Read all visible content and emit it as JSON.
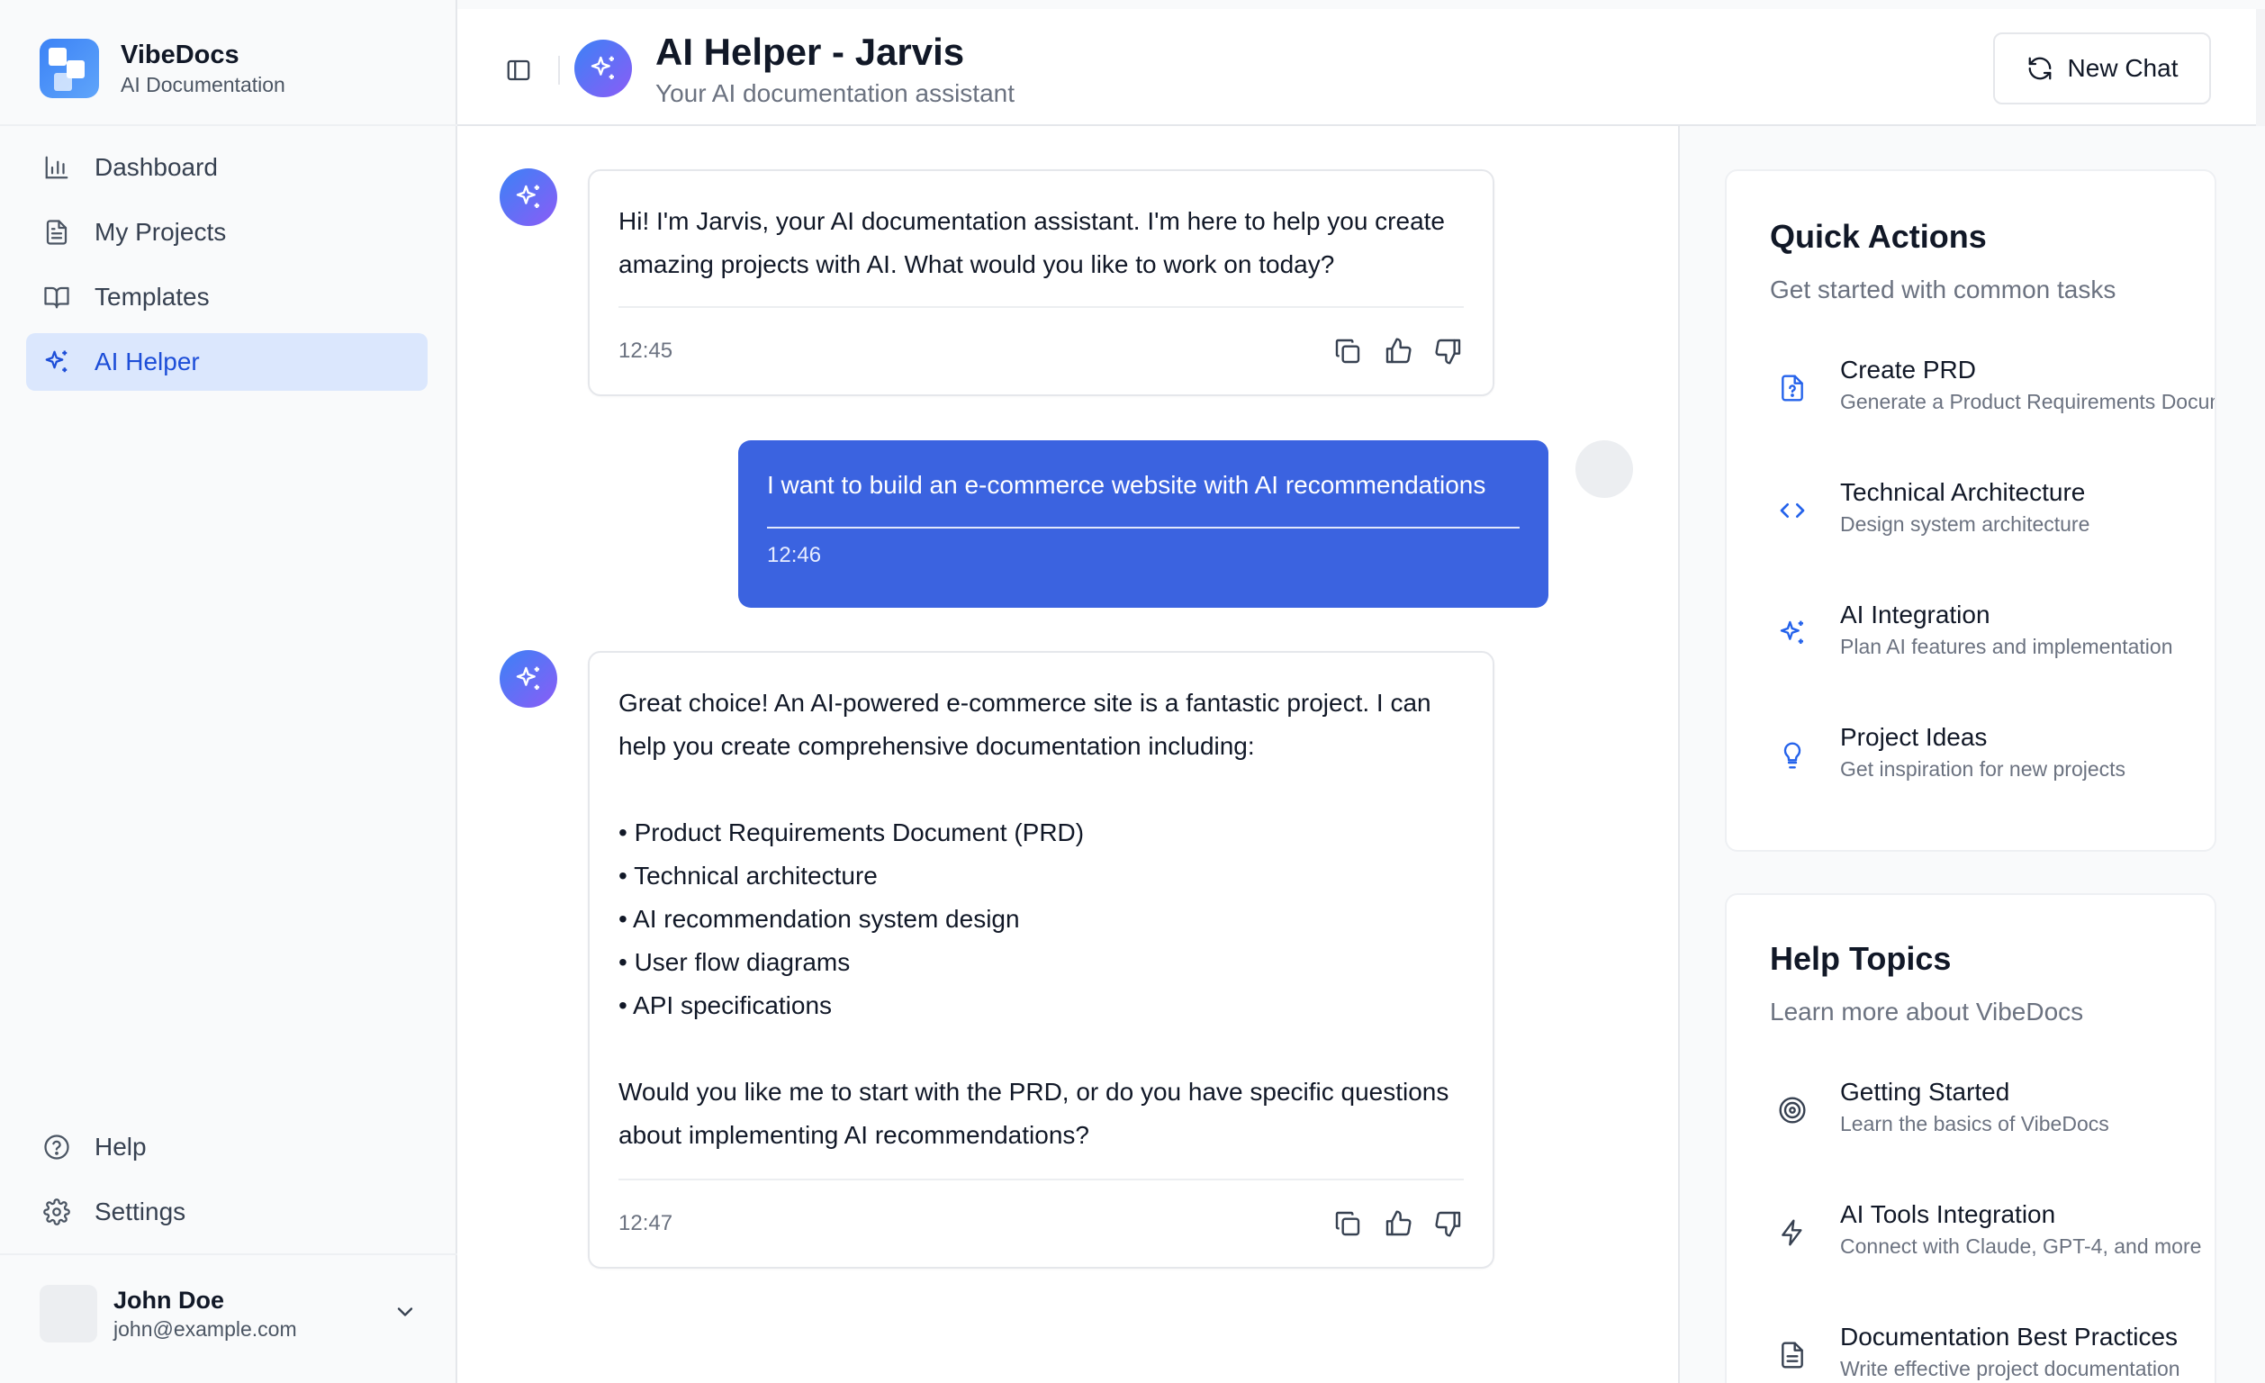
{
  "app": {
    "name": "VibeDocs",
    "subtitle": "AI Documentation"
  },
  "sidebar": {
    "items": [
      {
        "label": "Dashboard",
        "icon": "bar-chart-icon",
        "active": false
      },
      {
        "label": "My Projects",
        "icon": "document-icon",
        "active": false
      },
      {
        "label": "Templates",
        "icon": "book-open-icon",
        "active": false
      },
      {
        "label": "AI Helper",
        "icon": "sparkles-icon",
        "active": true
      }
    ],
    "bottom_items": [
      {
        "label": "Help",
        "icon": "help-circle-icon"
      },
      {
        "label": "Settings",
        "icon": "gear-icon"
      }
    ],
    "user": {
      "name": "John Doe",
      "email": "john@example.com"
    }
  },
  "header": {
    "title": "AI Helper - Jarvis",
    "subtitle": "Your AI documentation assistant",
    "new_chat_label": "New Chat"
  },
  "chat": {
    "messages": [
      {
        "role": "assistant",
        "text": "Hi! I'm Jarvis, your AI documentation assistant. I'm here to help you create amazing projects with AI. What would you like to work on today?",
        "time": "12:45"
      },
      {
        "role": "user",
        "text": "I want to build an e-commerce website with AI recommendations",
        "time": "12:46"
      },
      {
        "role": "assistant",
        "text": "Great choice! An AI-powered e-commerce site is a fantastic project. I can help you create comprehensive documentation including:\n\n• Product Requirements Document (PRD)\n• Technical architecture\n• AI recommendation system design\n• User flow diagrams\n• API specifications\n\nWould you like me to start with the PRD, or do you have specific questions about implementing AI recommendations?",
        "time": "12:47"
      }
    ]
  },
  "quick_actions": {
    "title": "Quick Actions",
    "description": "Get started with common tasks",
    "items": [
      {
        "title": "Create PRD",
        "subtitle": "Generate a Product Requirements Docum",
        "icon": "file-question-icon"
      },
      {
        "title": "Technical Architecture",
        "subtitle": "Design system architecture",
        "icon": "code-icon"
      },
      {
        "title": "AI Integration",
        "subtitle": "Plan AI features and implementation",
        "icon": "sparkles-icon"
      },
      {
        "title": "Project Ideas",
        "subtitle": "Get inspiration for new projects",
        "icon": "lightbulb-icon"
      }
    ]
  },
  "help_topics": {
    "title": "Help Topics",
    "description": "Learn more about VibeDocs",
    "items": [
      {
        "title": "Getting Started",
        "subtitle": "Learn the basics of VibeDocs",
        "icon": "target-icon"
      },
      {
        "title": "AI Tools Integration",
        "subtitle": "Connect with Claude, GPT-4, and more",
        "icon": "lightning-icon"
      },
      {
        "title": "Documentation Best Practices",
        "subtitle": "Write effective project documentation",
        "icon": "file-text-icon"
      }
    ]
  },
  "colors": {
    "accent": "#3b63e0",
    "active_nav_bg": "#dbe7fd",
    "active_nav_text": "#1d4ed8"
  }
}
